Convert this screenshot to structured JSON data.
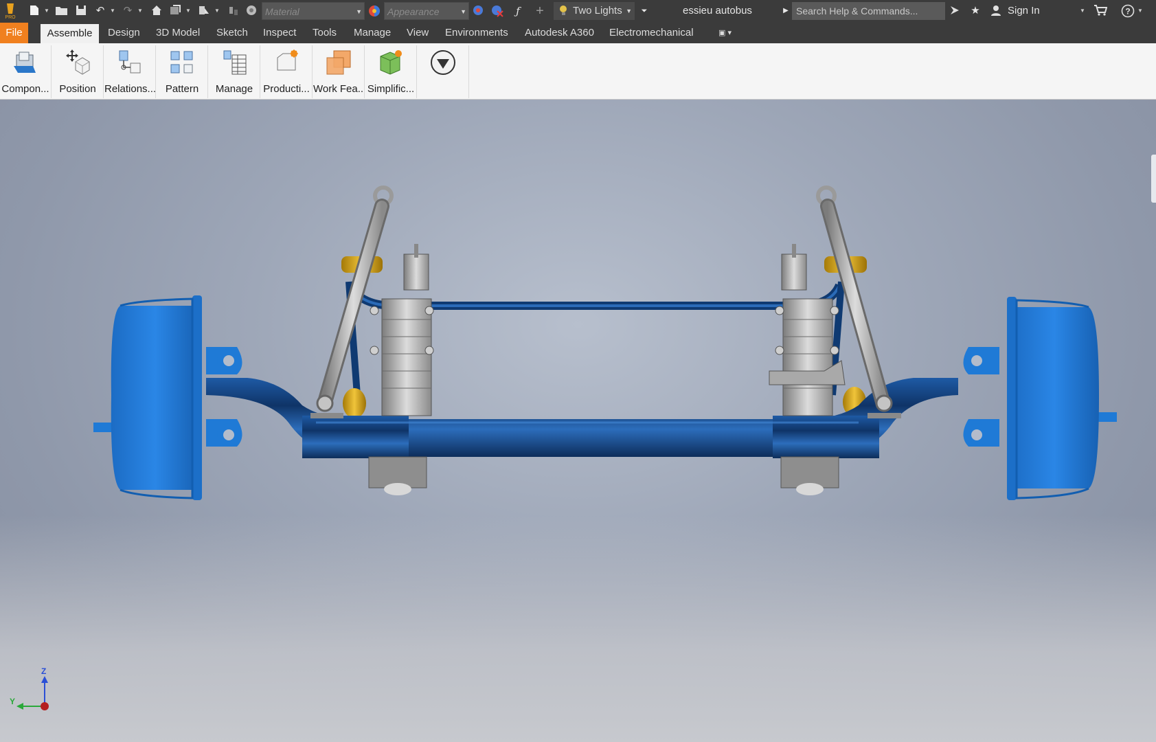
{
  "app": {
    "logo_text": "PRO"
  },
  "quick_access": {
    "material_placeholder": "Material",
    "appearance_placeholder": "Appearance",
    "lighting_style": "Two Lights",
    "document_title": "essieu autobus",
    "search_placeholder": "Search Help & Commands...",
    "sign_in_label": "Sign In"
  },
  "tabs": [
    {
      "label": "File"
    },
    {
      "label": "Assemble"
    },
    {
      "label": "Design"
    },
    {
      "label": "3D Model"
    },
    {
      "label": "Sketch"
    },
    {
      "label": "Inspect"
    },
    {
      "label": "Tools"
    },
    {
      "label": "Manage"
    },
    {
      "label": "View"
    },
    {
      "label": "Environments"
    },
    {
      "label": "Autodesk A360"
    },
    {
      "label": "Electromechanical"
    }
  ],
  "ribbon": {
    "buttons": [
      {
        "label": "Compon..."
      },
      {
        "label": "Position"
      },
      {
        "label": "Relations..."
      },
      {
        "label": "Pattern"
      },
      {
        "label": "Manage"
      },
      {
        "label": "Producti..."
      },
      {
        "label": "Work Fea..."
      },
      {
        "label": "Simplific..."
      }
    ]
  },
  "triad": {
    "z": "Z",
    "y": "Y"
  },
  "colors": {
    "accent_file_tab": "#f0801f",
    "model_blue": "#1f7ad6",
    "model_navy": "#123f7a",
    "model_gold": "#c99a12",
    "model_steel": "#b9b9b9"
  }
}
